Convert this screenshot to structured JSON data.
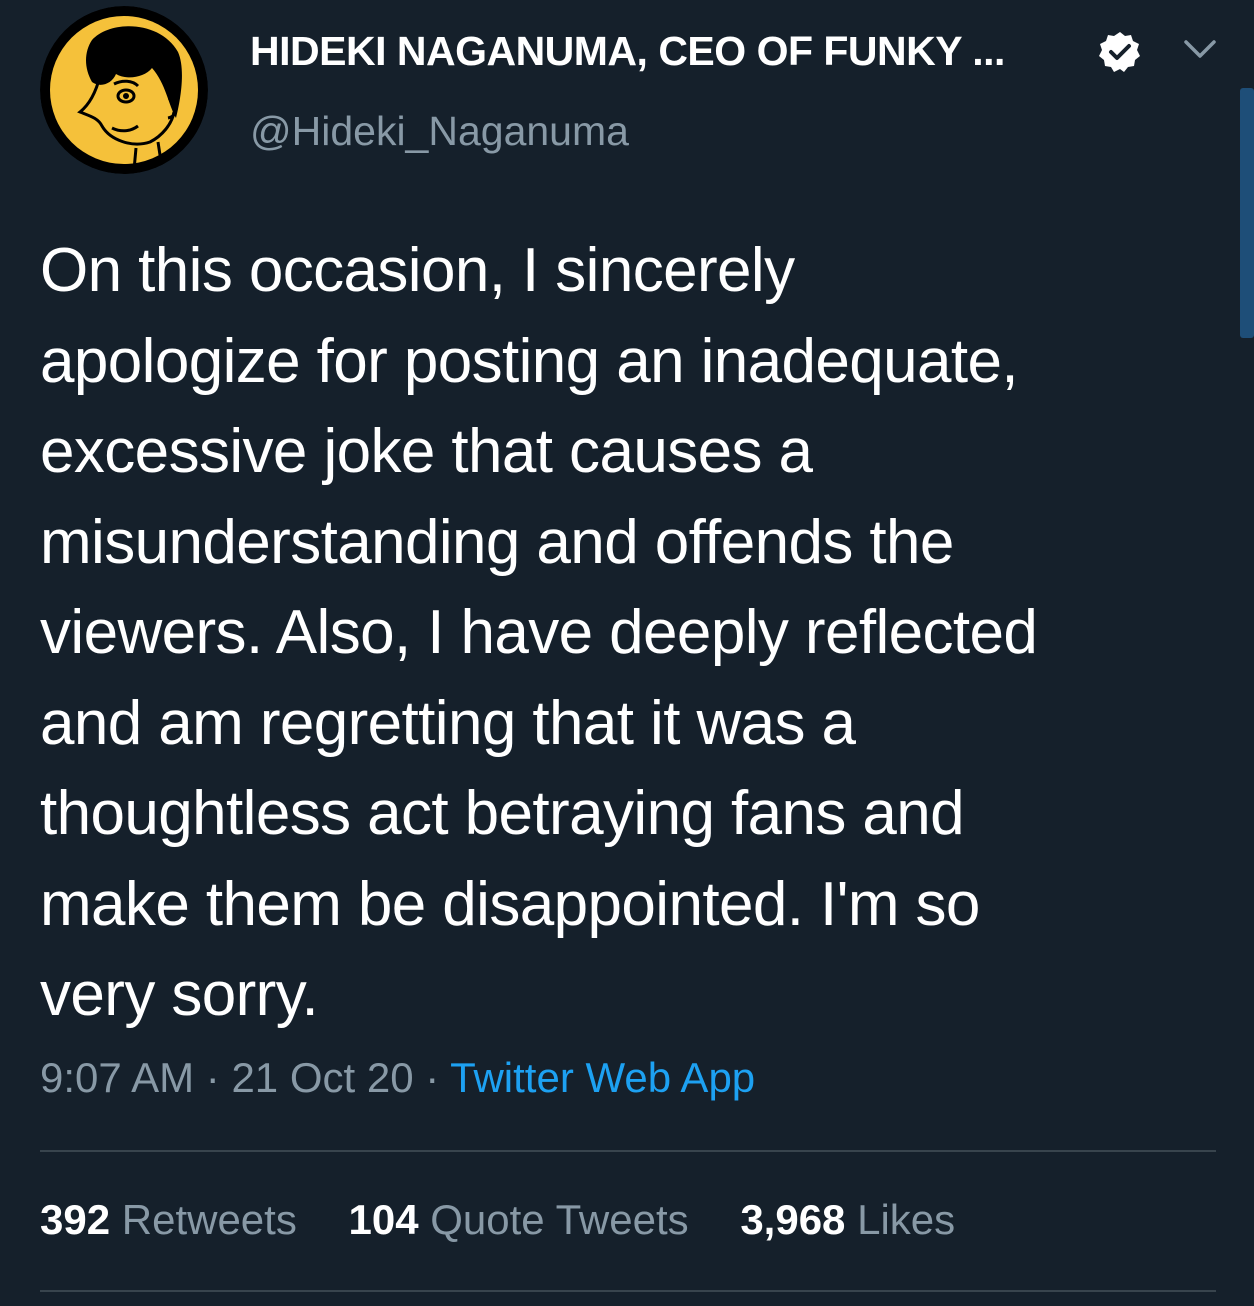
{
  "tweet": {
    "author": {
      "display_name": "HIDEKI NAGANUMA, CEO OF FUNKY ...",
      "handle": "@Hideki_Naganuma",
      "verified": true,
      "avatar_icon": "cartoon-avatar-icon"
    },
    "text": "On this occasion, I sincerely\napologize for posting an inadequate,\nexcessive joke that causes a\nmisunderstanding and offends the\nviewers. Also, I have deeply reflected\nand am regretting that it was a\nthoughtless act betraying fans and\nmake them be disappointed. I'm so\nvery sorry.",
    "meta": {
      "time": "9:07 AM",
      "separator": " · ",
      "date": "21 Oct 20",
      "source": "Twitter Web App"
    },
    "stats": {
      "retweets_count": "392",
      "retweets_label": "Retweets",
      "quote_tweets_count": "104",
      "quote_tweets_label": "Quote Tweets",
      "likes_count": "3,968",
      "likes_label": "Likes"
    }
  },
  "colors": {
    "background": "#15202b",
    "text_primary": "#ffffff",
    "text_secondary": "#8899a6",
    "link": "#1da1f2",
    "divider": "#38444d",
    "avatar_bg": "#f5c13a"
  }
}
